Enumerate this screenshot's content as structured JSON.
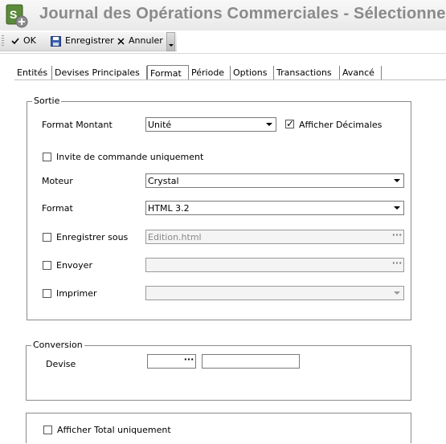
{
  "window": {
    "title": "Journal des Opérations Commerciales - Sélectionner",
    "app_icon": "sage-app-icon"
  },
  "toolbar": {
    "ok_label": "OK",
    "save_label": "Enregistrer",
    "cancel_label": "Annuler"
  },
  "tabs": [
    "Entités",
    "Devises Principales",
    "Format",
    "Période",
    "Options",
    "Transactions",
    "Avancé"
  ],
  "active_tab": "Format",
  "sortie": {
    "legend": "Sortie",
    "format_montant": {
      "label": "Format Montant",
      "value": "Unité"
    },
    "afficher_decimales": {
      "label": "Afficher Décimales",
      "checked": true
    },
    "invite_commande": {
      "label": "Invite de commande uniquement",
      "checked": false
    },
    "moteur": {
      "label": "Moteur",
      "value": "Crystal"
    },
    "format": {
      "label": "Format",
      "value": "HTML 3.2"
    },
    "enregistrer_sous": {
      "label": "Enregistrer sous",
      "checked": false,
      "value": "Edition.html"
    },
    "envoyer": {
      "label": "Envoyer",
      "checked": false,
      "value": ""
    },
    "imprimer": {
      "label": "Imprimer",
      "checked": false,
      "value": ""
    }
  },
  "conversion": {
    "legend": "Conversion",
    "devise": {
      "label": "Devise",
      "code": "",
      "description": ""
    }
  },
  "afficher_total": {
    "label": "Afficher Total uniquement",
    "checked": false
  }
}
